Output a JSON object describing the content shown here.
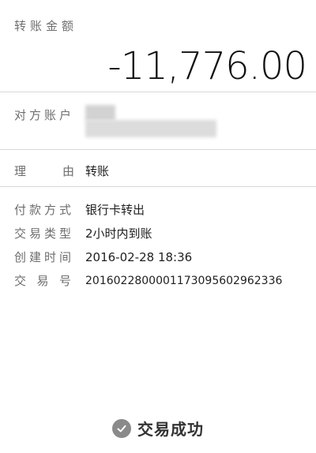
{
  "amount": {
    "label": "转账金额",
    "value": "-11,776.00"
  },
  "counterparty": {
    "label": "对方账户",
    "name": "",
    "account": ""
  },
  "reason": {
    "label_left": "理",
    "label_right": "由",
    "value": "转账"
  },
  "details": [
    {
      "label": "付款方式",
      "value": "银行卡转出"
    },
    {
      "label": "交易类型",
      "value": "2小时内到账"
    },
    {
      "label": "创建时间",
      "value": "2016-02-28 18:36"
    },
    {
      "label": "交易号",
      "value": "20160228000011730956029623 36"
    }
  ],
  "tx_id": {
    "label_chars": [
      "交",
      "易",
      "号"
    ],
    "value": "2016022800001173095602962336"
  },
  "footer": {
    "status": "交易成功",
    "icon": "check-circle-icon"
  },
  "colors": {
    "background": "#ffffff",
    "divider": "#d8d8d8",
    "label": "#6e6e6e",
    "text": "#1f1f1f",
    "icon": "#8a8a8a"
  }
}
